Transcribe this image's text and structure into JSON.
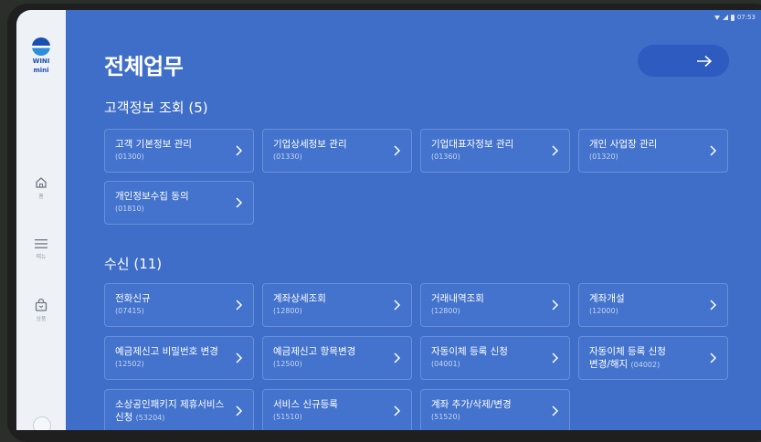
{
  "status_bar": {
    "time": "07:53"
  },
  "sidebar": {
    "logo": {
      "line1": "WINI",
      "line2": "mini"
    },
    "items": [
      {
        "label": "홈",
        "icon": "home-icon"
      },
      {
        "label": "메뉴",
        "icon": "menu-icon"
      },
      {
        "label": "상품",
        "icon": "bag-icon"
      }
    ]
  },
  "header": {
    "title": "전체업무",
    "action_icon": "arrow-right-icon"
  },
  "sections": [
    {
      "title": "고객정보 조회 (5)",
      "cards": [
        {
          "name": "고객 기본정보 관리",
          "code": "(01300)"
        },
        {
          "name": "기업상세정보 관리",
          "code": "(01330)"
        },
        {
          "name": "기업대표자정보 관리",
          "code": "(01360)"
        },
        {
          "name": "개인 사업장 관리",
          "code": "(01320)"
        },
        {
          "name": "개인정보수집 동의",
          "code": "(01810)"
        }
      ]
    },
    {
      "title": "수신 (11)",
      "cards": [
        {
          "name": "전화신규",
          "code": "(07415)"
        },
        {
          "name": "계좌상세조회",
          "code": "(12800)"
        },
        {
          "name": "거래내역조회",
          "code": "(12800)"
        },
        {
          "name": "계좌개설",
          "code": "(12000)"
        },
        {
          "name": "예금제신고 비밀번호 변경",
          "code": "(12502)"
        },
        {
          "name": "예금제신고 항목변경",
          "code": "(12500)"
        },
        {
          "name": "자동이체 등록 신청",
          "code": "(04001)"
        },
        {
          "name": "자동이체 등록 신청",
          "name2": "변경/해지",
          "code": "(04002)"
        },
        {
          "name": "소상공인패키지 제휴서비스",
          "name2": "신청",
          "code": "(53204)"
        },
        {
          "name": "서비스 신규등록",
          "code": "(51510)"
        },
        {
          "name": "계좌 추가/삭제/변경",
          "code": "(51520)"
        }
      ]
    }
  ]
}
